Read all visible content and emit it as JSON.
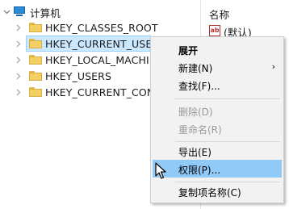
{
  "tree": {
    "root_label": "计算机",
    "items": [
      {
        "label": "HKEY_CLASSES_ROOT"
      },
      {
        "label": "HKEY_CURRENT_USER"
      },
      {
        "label": "HKEY_LOCAL_MACHINE"
      },
      {
        "label": "HKEY_USERS"
      },
      {
        "label": "HKEY_CURRENT_CONFIG"
      }
    ]
  },
  "detail": {
    "column_name": "名称",
    "value_icon_text": "ab",
    "value_name": "(默认)"
  },
  "menu": {
    "items": [
      {
        "label": "展开"
      },
      {
        "label": "新建(N)",
        "arrow": "›"
      },
      {
        "label": "查找(F)..."
      },
      {
        "label": "删除(D)"
      },
      {
        "label": "重命名(R)"
      },
      {
        "label": "导出(E)"
      },
      {
        "label": "权限(P)..."
      },
      {
        "label": "复制项名称(C)"
      }
    ]
  },
  "colors": {
    "selection": "#cce8ff",
    "menu_highlight": "#91c9f7",
    "folder": "#f3cf66"
  }
}
